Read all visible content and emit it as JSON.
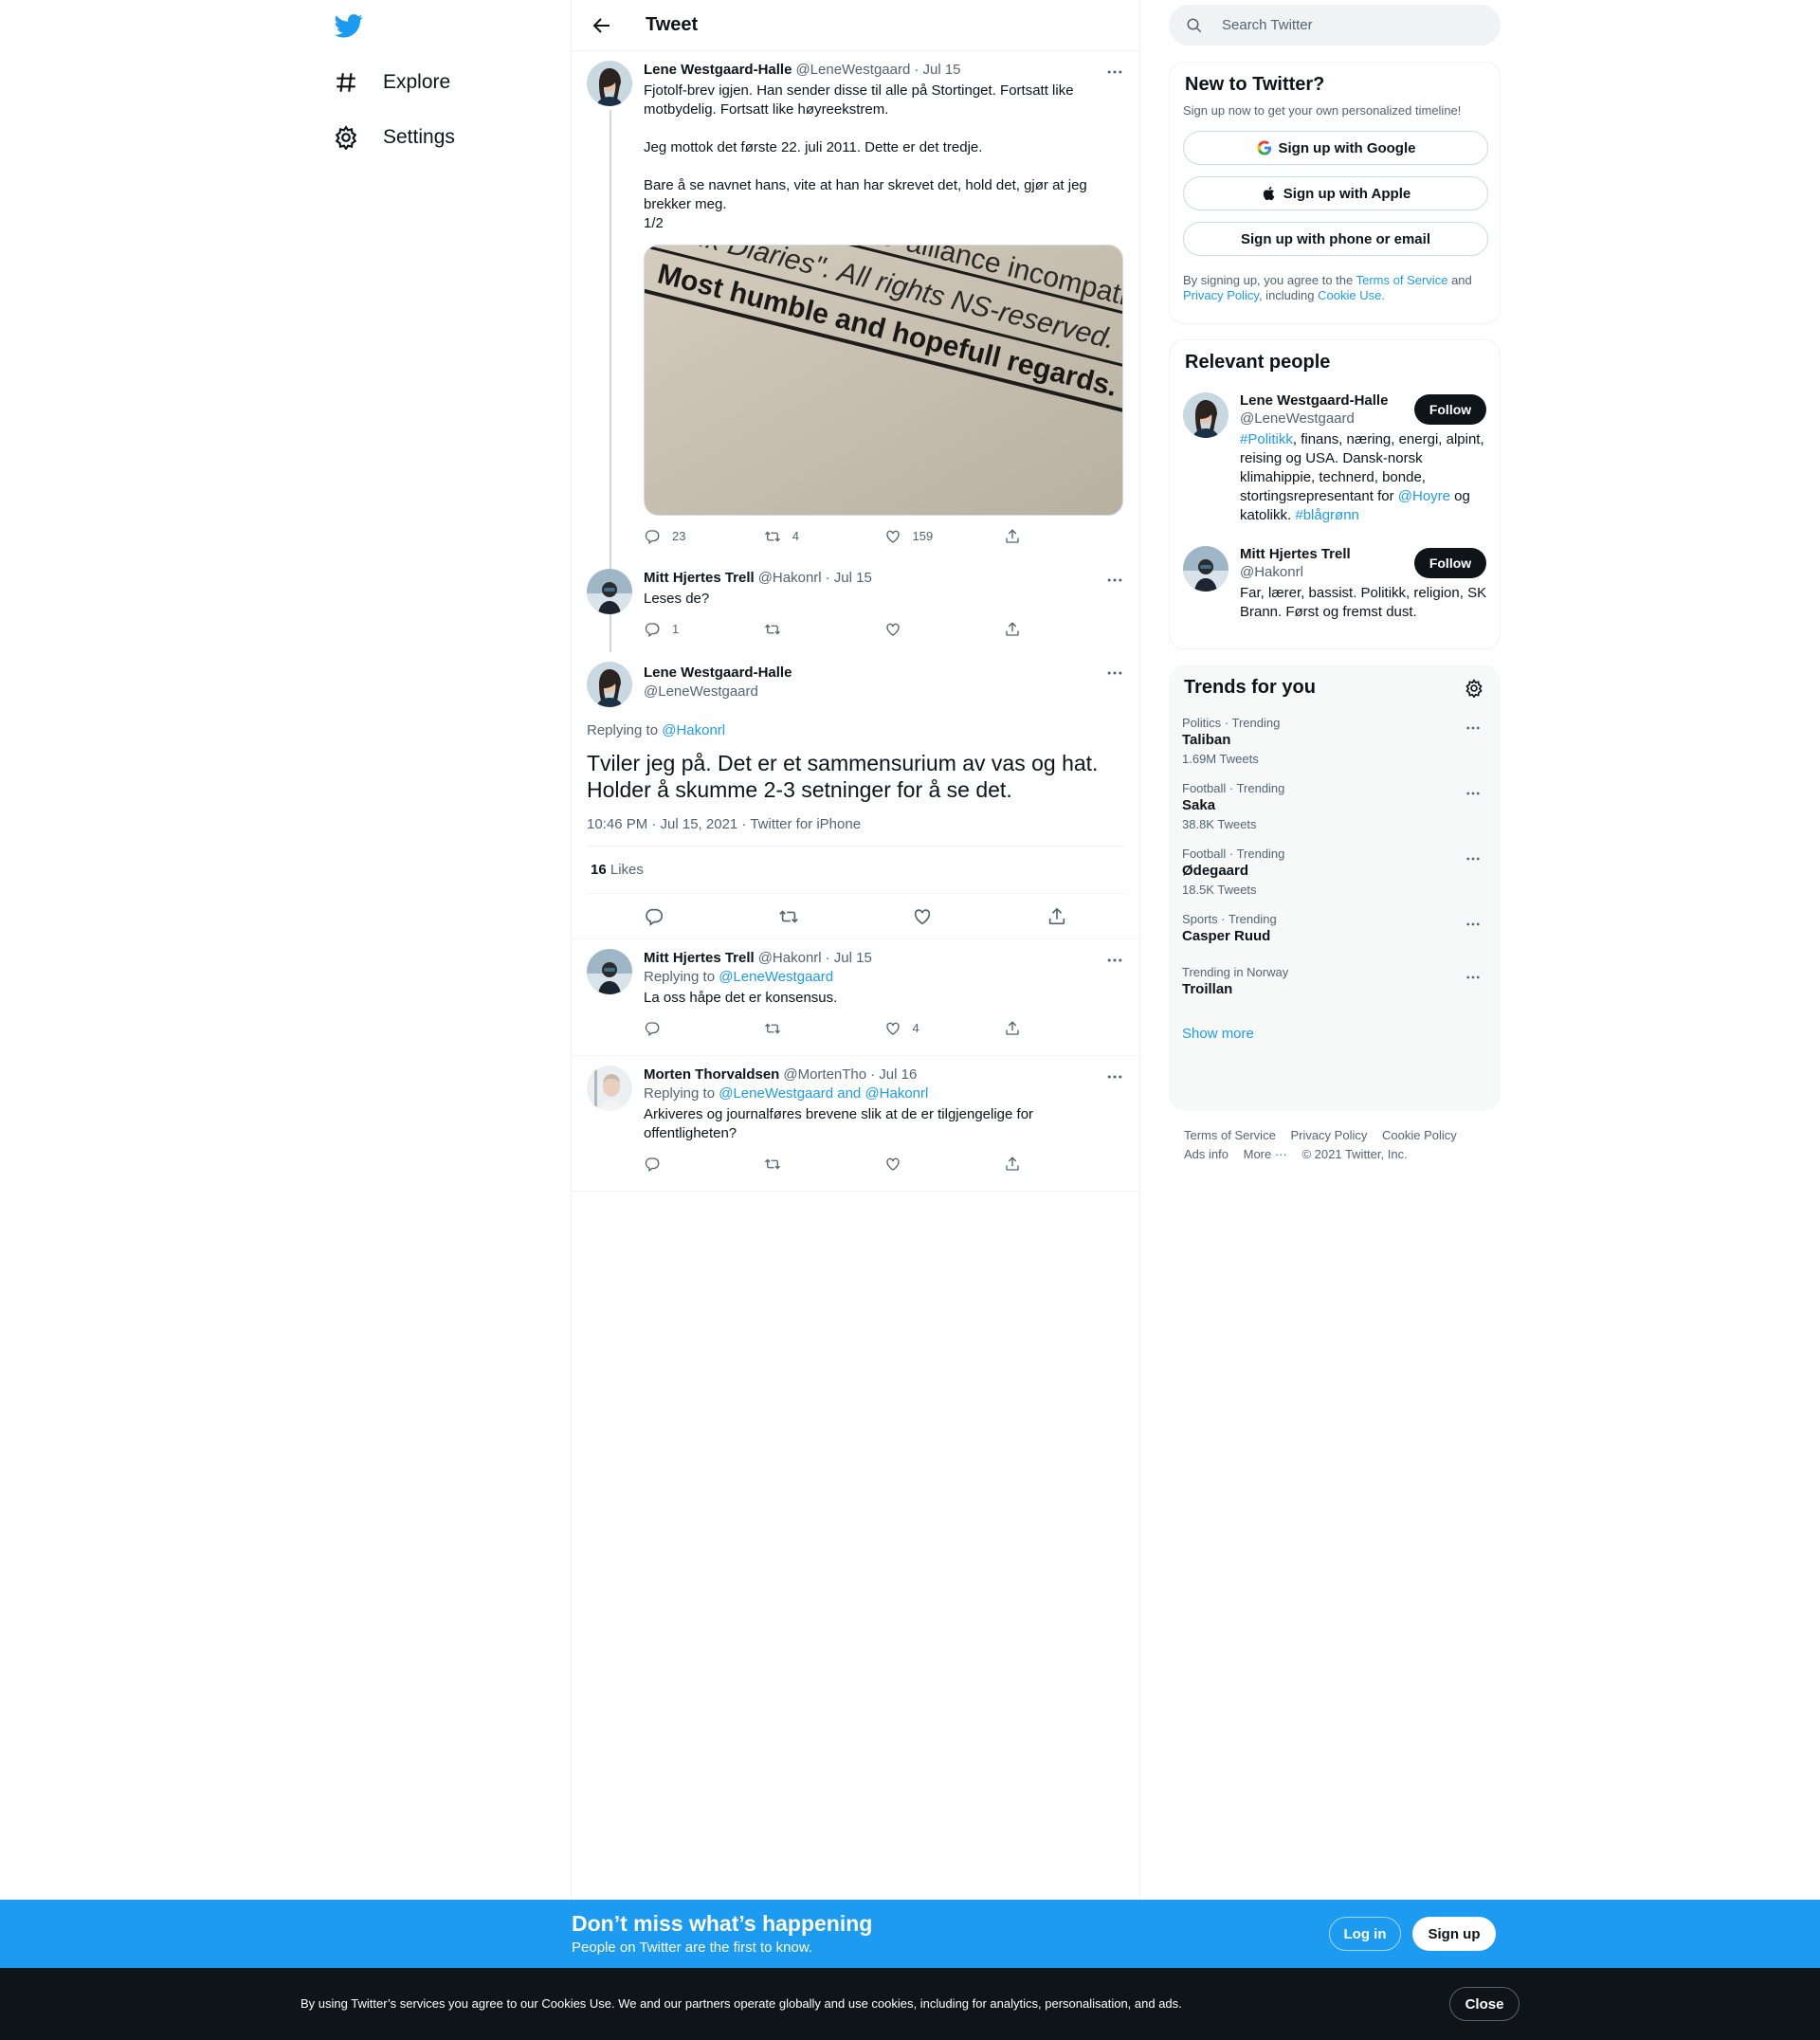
{
  "nav": {
    "explore": "Explore",
    "settings": "Settings"
  },
  "header": {
    "title": "Tweet"
  },
  "thread": [
    {
      "name": "Lene Westgaard-Halle",
      "handle": "@LeneWestgaard",
      "date": "· Jul 15",
      "text": "Fjotolf-brev igjen. Han sender disse til alle på Stortinget. Fortsatt like motbydelig. Fortsatt like høyreekstrem.\n\nJeg mottok det første 22. juli 2011. Dette er det tredje.\n\nBare å se navnet hans, vite at han har skrevet det, hold det, gjør at jeg brekker meg.\n1/2",
      "image_lines": [
        "NATO-alliance incompatib",
        "eivik Diaries\". All rights NS-reserved.",
        "Most humble and hopefull regards."
      ],
      "replies": "23",
      "retweets": "4",
      "likes": "159"
    },
    {
      "name": "Mitt Hjertes Trell",
      "handle": "@Hakonrl",
      "date": "· Jul 15",
      "text": "Leses de?",
      "replies": "1",
      "retweets": "",
      "likes": ""
    }
  ],
  "focus": {
    "name": "Lene Westgaard-Halle",
    "handle": "@LeneWestgaard",
    "replying_prefix": "Replying to",
    "replying_to": "@Hakonrl",
    "text": "Tviler jeg på. Det er et sammensurium av vas og hat. Holder å skumme 2-3 setninger for å se det.",
    "timestamp": "10:46 PM · Jul 15, 2021 · Twitter for iPhone",
    "likes_count": "16",
    "likes_label": "Likes"
  },
  "replies": [
    {
      "name": "Mitt Hjertes Trell",
      "handle": "@Hakonrl",
      "date": "· Jul 15",
      "replying_prefix": "Replying to",
      "replying_to": "@LeneWestgaard",
      "text": "La oss håpe det er konsensus.",
      "replies": "",
      "retweets": "",
      "likes": "4"
    },
    {
      "name": "Morten Thorvaldsen",
      "handle": "@MortenTho",
      "date": "· Jul 16",
      "replying_prefix": "Replying to",
      "replying_to": "@LeneWestgaard and @Hakonrl",
      "text": "Arkiveres og journalføres brevene slik at de er tilgjengelige for offentligheten?",
      "replies": "",
      "retweets": "",
      "likes": ""
    }
  ],
  "search": {
    "placeholder": "Search Twitter"
  },
  "signup_card": {
    "title": "New to Twitter?",
    "subtitle": "Sign up now to get your own personalized timeline!",
    "google": "Sign up with Google",
    "apple": "Sign up with Apple",
    "phone": "Sign up with phone or email",
    "legal_1": "By signing up, you agree to the",
    "tos": "Terms of Service",
    "and": "and",
    "privacy": "Privacy Policy",
    "including": ", including",
    "cookie": "Cookie Use."
  },
  "relevant": {
    "title": "Relevant people",
    "follow": "Follow",
    "people": [
      {
        "name": "Lene Westgaard-Halle",
        "handle": "@LeneWestgaard",
        "bio_tag": "#Politikk",
        "bio_1": ", finans, næring, energi, alpint, reising og USA. Dansk-norsk klimahippie, technerd, bonde, stortingsrepresentant for ",
        "bio_mention": "@Hoyre",
        "bio_2": " og katolikk. ",
        "bio_tag2": "#blågrønn"
      },
      {
        "name": "Mitt Hjertes Trell",
        "handle": "@Hakonrl",
        "bio": "Far, lærer, bassist. Politikk, religion, SK Brann. Først og fremst dust."
      }
    ]
  },
  "trends": {
    "title": "Trends for you",
    "items": [
      {
        "category": "Politics · Trending",
        "name": "Taliban",
        "count": "1.69M Tweets"
      },
      {
        "category": "Football · Trending",
        "name": "Saka",
        "count": "38.8K Tweets"
      },
      {
        "category": "Football · Trending",
        "name": "Ødegaard",
        "count": "18.5K Tweets"
      },
      {
        "category": "Sports · Trending",
        "name": "Casper Ruud",
        "count": ""
      },
      {
        "category": "Trending in Norway",
        "name": "Troillan",
        "count": ""
      }
    ],
    "show_more": "Show more"
  },
  "footer": {
    "tos": "Terms of Service",
    "privacy": "Privacy Policy",
    "cookie": "Cookie Policy",
    "ads": "Ads info",
    "more": "More ···",
    "copyright": "© 2021 Twitter, Inc."
  },
  "promo": {
    "title": "Don’t miss what’s happening",
    "subtitle": "People on Twitter are the first to know.",
    "login": "Log in",
    "signup": "Sign up"
  },
  "cookie_bar": {
    "text": "By using Twitter’s services you agree to our Cookies Use. We and our partners operate globally and use cookies, including for analytics, personalisation, and ads.",
    "close": "Close"
  },
  "colors": {
    "accent": "#1d9bf0",
    "text": "#0f1419",
    "muted": "#536471"
  }
}
